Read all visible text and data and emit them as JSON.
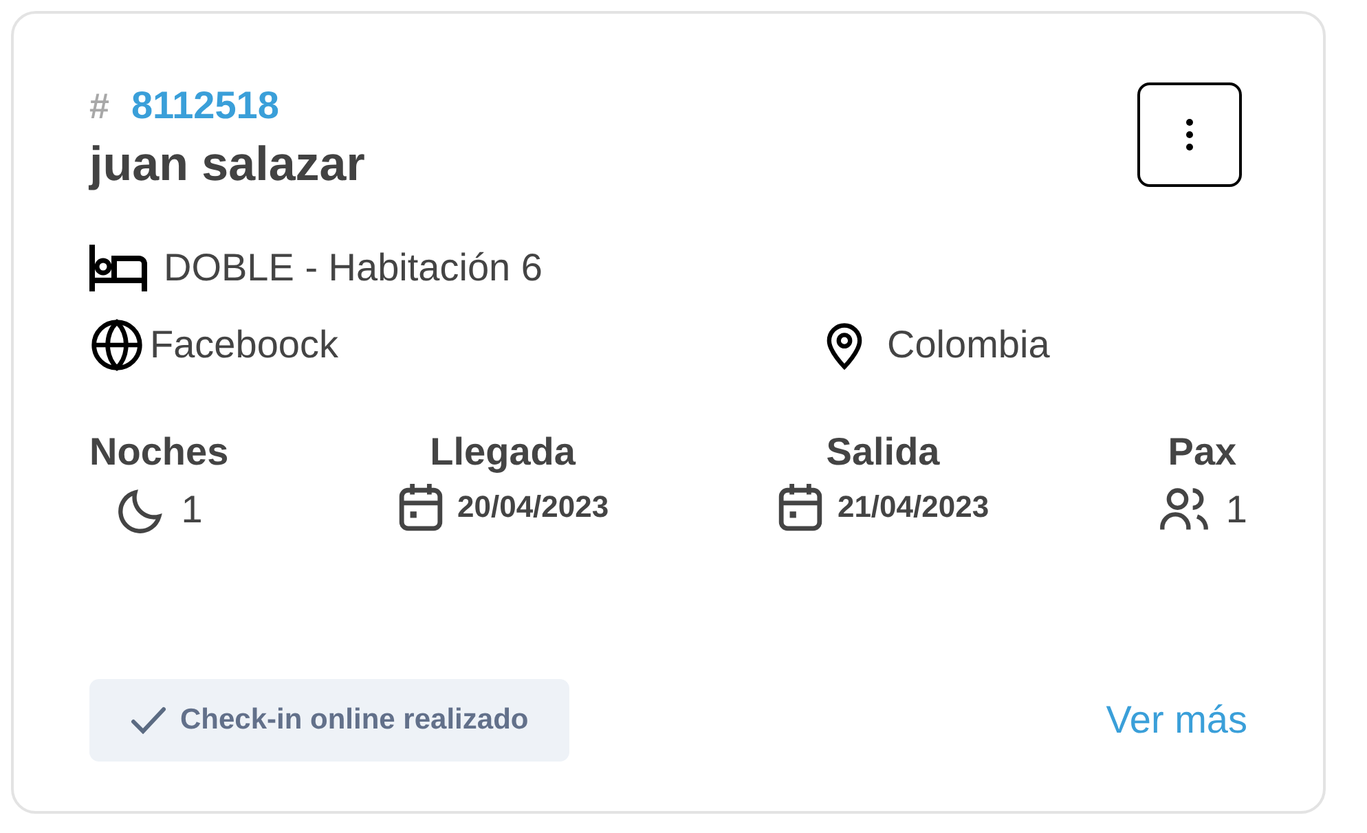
{
  "booking": {
    "hash": "#",
    "number": "8112518",
    "guest": "juan salazar"
  },
  "room": "DOBLE - Habitación 6",
  "source": "Faceboock",
  "country": "Colombia",
  "stats": [
    {
      "kind": "nights",
      "label": "Noches",
      "value": "1"
    },
    {
      "kind": "date",
      "label": "Llegada",
      "value": "20/04/2023"
    },
    {
      "kind": "date",
      "label": "Salida",
      "value": "21/04/2023"
    },
    {
      "kind": "guests",
      "label": "Pax",
      "value": "1"
    }
  ],
  "status": {
    "label": "Check-in online realizado"
  },
  "link": "Ver más"
}
